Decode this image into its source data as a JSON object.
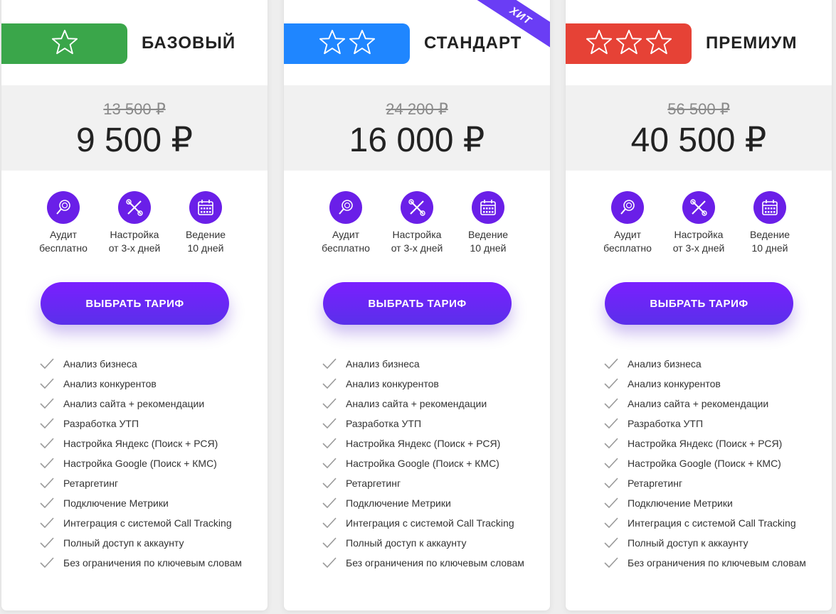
{
  "colors": {
    "green": "#3aa64a",
    "blue": "#1f86ff",
    "red": "#e64236",
    "accent_purple": "#6a1fe8",
    "ribbon_purple": "#6a3df5"
  },
  "plans": [
    {
      "name": "БАЗОВЫЙ",
      "stars": 1,
      "star_color": "green",
      "old_price": "13 500 ₽",
      "price": "9 500 ₽",
      "badge": ""
    },
    {
      "name": "СТАНДАРТ",
      "stars": 2,
      "star_color": "blue",
      "old_price": "24 200 ₽",
      "price": "16 000 ₽",
      "badge": "ХИТ"
    },
    {
      "name": "ПРЕМИУМ",
      "stars": 3,
      "star_color": "red",
      "old_price": "56 500 ₽",
      "price": "40 500 ₽",
      "badge": ""
    }
  ],
  "features": [
    {
      "icon": "magnifier-icon",
      "line1": "Аудит",
      "line2": "бесплатно"
    },
    {
      "icon": "tools-icon",
      "line1": "Настройка",
      "line2": "от 3-х дней"
    },
    {
      "icon": "calendar-icon",
      "line1": "Ведение",
      "line2": "10 дней"
    }
  ],
  "button_label": "ВЫБРАТЬ ТАРИФ",
  "checklist": [
    "Анализ бизнеса",
    "Анализ конкурентов",
    "Анализ сайта + рекомендации",
    "Разработка УТП",
    "Настройка Яндекс (Поиск + РСЯ)",
    "Настройка Google (Поиск + КМС)",
    "Ретаргетинг",
    "Подключение Метрики",
    "Интеграция с системой Call Tracking",
    "Полный доступ к аккаунту",
    "Без ограничения по ключевым словам"
  ]
}
